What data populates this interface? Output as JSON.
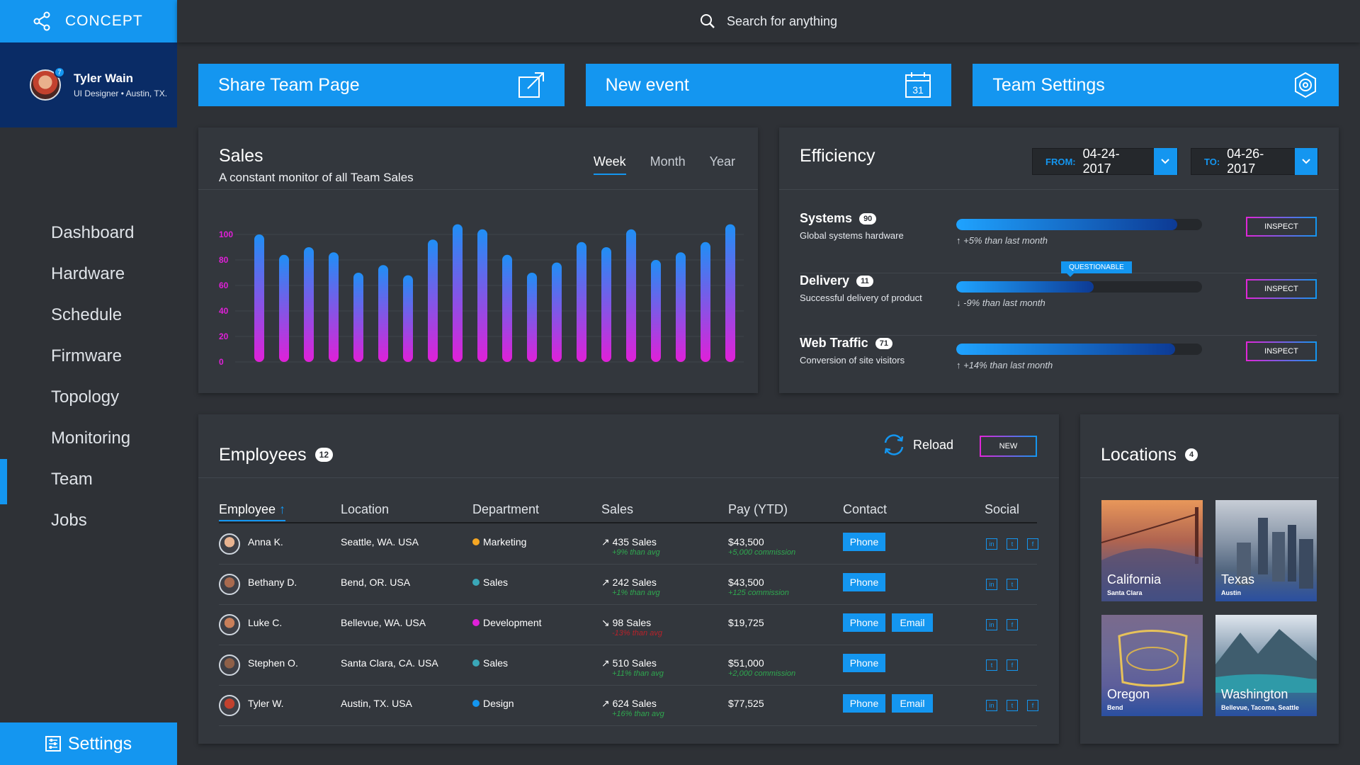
{
  "brand": {
    "name": "CONCEPT"
  },
  "user": {
    "name": "Tyler Wain",
    "subtitle": "UI Designer • Austin, TX.",
    "badge": "7"
  },
  "search": {
    "placeholder": "Search for anything"
  },
  "nav": {
    "items": [
      "Dashboard",
      "Hardware",
      "Schedule",
      "Firmware",
      "Topology",
      "Monitoring",
      "Team",
      "Jobs"
    ],
    "active": "Team"
  },
  "settings_label": "Settings",
  "actions": {
    "share": "Share Team Page",
    "new_event": "New event",
    "calendar_day": "31",
    "team_settings": "Team Settings"
  },
  "sales": {
    "title": "Sales",
    "subtitle": "A constant monitor of all Team Sales",
    "tabs": [
      "Week",
      "Month",
      "Year"
    ],
    "active_tab": "Week"
  },
  "chart_data": {
    "type": "bar",
    "title": "Sales",
    "ylim": [
      0,
      100
    ],
    "yticks": [
      100,
      80,
      60,
      40,
      20,
      0
    ],
    "values": [
      100,
      84,
      90,
      86,
      70,
      76,
      68,
      96,
      108,
      104,
      84,
      70,
      78,
      94,
      90,
      104,
      80,
      86,
      94,
      108
    ],
    "colors": {
      "top": "#1f8ff5",
      "bottom": "#e020d8"
    }
  },
  "efficiency": {
    "title": "Efficiency",
    "from_label": "FROM:",
    "from_date": "04-24-2017",
    "to_label": "TO:",
    "to_date": "04-26-2017",
    "tooltip": "QUESTIONABLE",
    "inspect_label": "INSPECT",
    "rows": [
      {
        "name": "Systems",
        "count": "90",
        "desc": "Global systems hardware",
        "trend": "↑ +5% than last month",
        "level": 0.9
      },
      {
        "name": "Delivery",
        "count": "11",
        "desc": "Successful delivery of product",
        "trend": "↓ -9% than last month",
        "level": 0.56
      },
      {
        "name": "Web Traffic",
        "count": "71",
        "desc": "Conversion of site visitors",
        "trend": "↑ +14% than last month",
        "level": 0.89
      }
    ]
  },
  "employees": {
    "title": "Employees",
    "count": "12",
    "reload": "Reload",
    "new": "NEW",
    "columns": [
      "Employee",
      "Location",
      "Department",
      "Sales",
      "Pay (YTD)",
      "Contact",
      "Social"
    ],
    "sort_arrow": "↑",
    "rows": [
      {
        "name": "Anna K.",
        "location": "Seattle, WA. USA",
        "dept": "Marketing",
        "dept_color": "#f5a623",
        "sales": "435 Sales",
        "sales_arrow": "↗",
        "sales_note": "+9% than avg",
        "note_color": "green",
        "pay": "$43,500",
        "pay_note": "+5,000 commission",
        "contacts": [
          "Phone"
        ],
        "social": [
          "in",
          "t",
          "f"
        ]
      },
      {
        "name": "Bethany D.",
        "location": "Bend, OR. USA",
        "dept": "Sales",
        "dept_color": "#3aa7b8",
        "sales": "242 Sales",
        "sales_arrow": "↗",
        "sales_note": "+1% than avg",
        "note_color": "green",
        "pay": "$43,500",
        "pay_note": "+125 commission",
        "contacts": [
          "Phone"
        ],
        "social": [
          "in",
          "t"
        ]
      },
      {
        "name": "Luke C.",
        "location": "Bellevue, WA. USA",
        "dept": "Development",
        "dept_color": "#e020d8",
        "sales": "98 Sales",
        "sales_arrow": "↘",
        "sales_note": "-13% than avg",
        "note_color": "red",
        "pay": "$19,725",
        "pay_note": "",
        "contacts": [
          "Phone",
          "Email"
        ],
        "social": [
          "in",
          "f"
        ]
      },
      {
        "name": "Stephen O.",
        "location": "Santa Clara, CA. USA",
        "dept": "Sales",
        "dept_color": "#3aa7b8",
        "sales": "510 Sales",
        "sales_arrow": "↗",
        "sales_note": "+11% than avg",
        "note_color": "green",
        "pay": "$51,000",
        "pay_note": "+2,000 commission",
        "contacts": [
          "Phone"
        ],
        "social": [
          "t",
          "f"
        ]
      },
      {
        "name": "Tyler W.",
        "location": "Austin, TX. USA",
        "dept": "Design",
        "dept_color": "#1496f0",
        "sales": "624 Sales",
        "sales_arrow": "↗",
        "sales_note": "+16% than avg",
        "note_color": "green",
        "pay": "$77,525",
        "pay_note": "",
        "contacts": [
          "Phone",
          "Email"
        ],
        "social": [
          "in",
          "t",
          "f"
        ]
      }
    ]
  },
  "locations": {
    "title": "Locations",
    "count": "4",
    "tiles": [
      {
        "name": "California",
        "sub": "Santa Clara"
      },
      {
        "name": "Texas",
        "sub": "Austin"
      },
      {
        "name": "Oregon",
        "sub": "Bend"
      },
      {
        "name": "Washington",
        "sub": "Bellevue, Tacoma, Seattle"
      }
    ]
  }
}
